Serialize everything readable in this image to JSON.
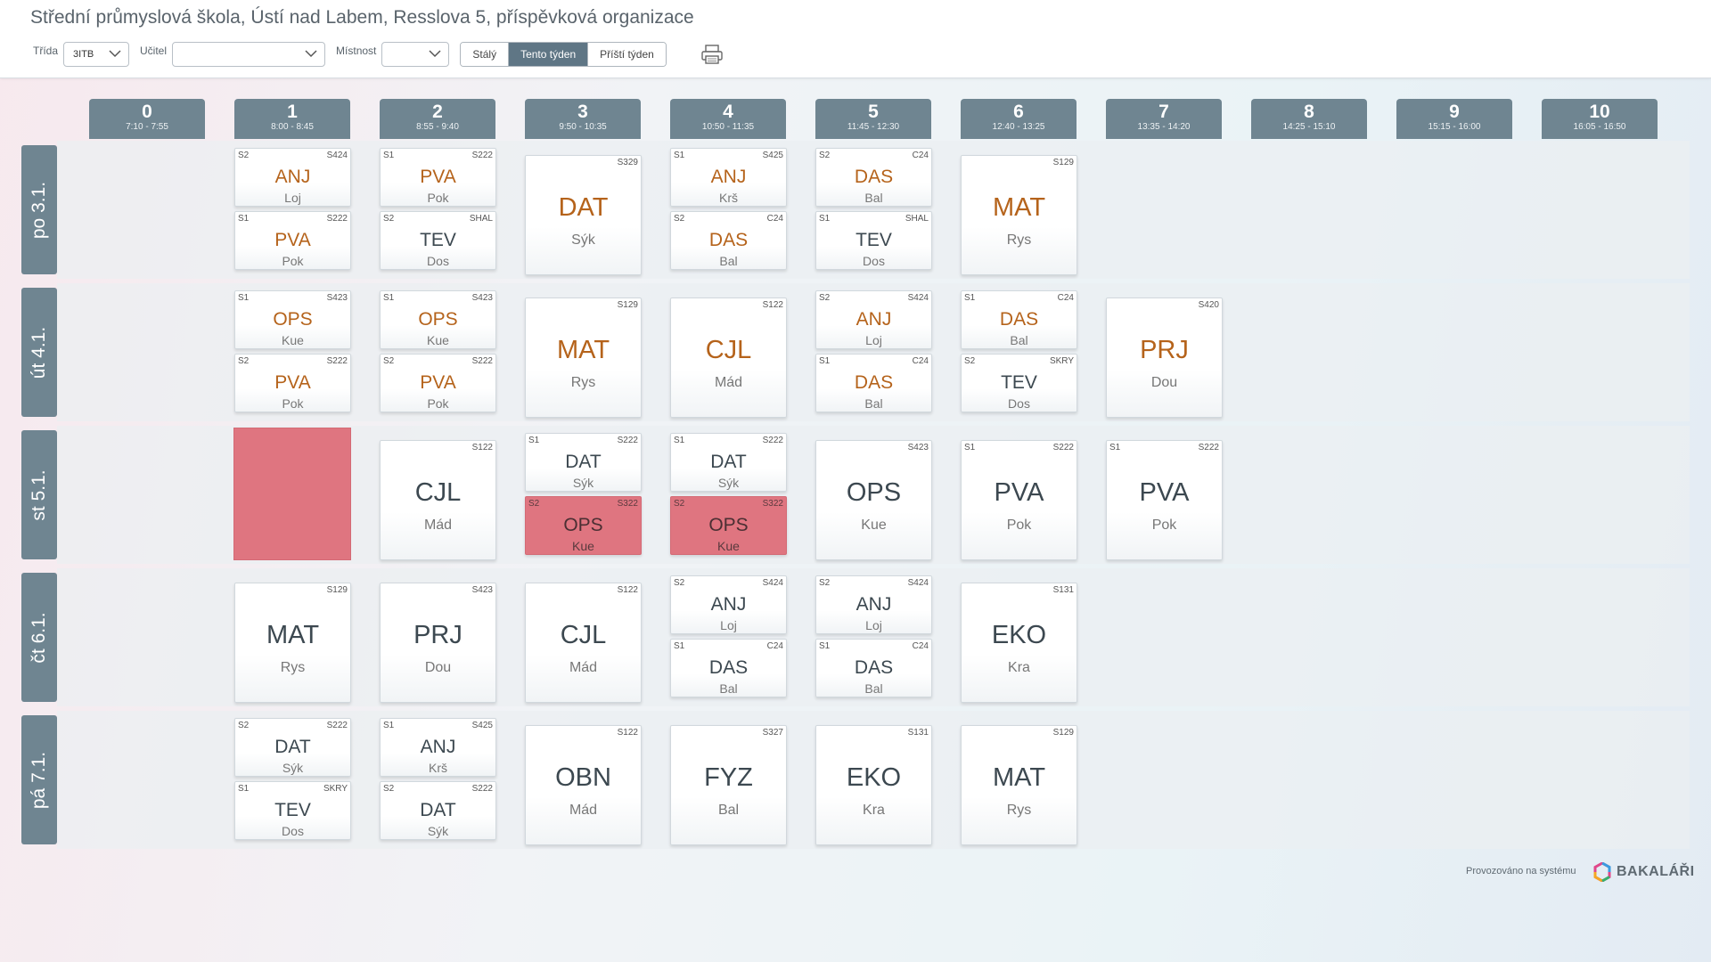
{
  "header": {
    "school": "Střední průmyslová škola, Ústí nad Labem, Resslova 5, příspěvková organizace",
    "filters": {
      "trida_label": "Třída",
      "trida_value": "3ITB",
      "ucitel_label": "Učitel",
      "ucitel_value": "",
      "mistnost_label": "Místnost",
      "mistnost_value": ""
    },
    "view_tabs": [
      "Stálý",
      "Tento týden",
      "Příští týden"
    ],
    "active_tab": "Tento týden",
    "print_icon": "printer-icon"
  },
  "hours": [
    {
      "num": "0",
      "time": "7:10 - 7:55"
    },
    {
      "num": "1",
      "time": "8:00 - 8:45"
    },
    {
      "num": "2",
      "time": "8:55 - 9:40"
    },
    {
      "num": "3",
      "time": "9:50 - 10:35"
    },
    {
      "num": "4",
      "time": "10:50 - 11:35"
    },
    {
      "num": "5",
      "time": "11:45 - 12:30"
    },
    {
      "num": "6",
      "time": "12:40 - 13:25"
    },
    {
      "num": "7",
      "time": "13:35 - 14:20"
    },
    {
      "num": "8",
      "time": "14:25 - 15:10"
    },
    {
      "num": "9",
      "time": "15:15 - 16:00"
    },
    {
      "num": "10",
      "time": "16:05 - 16:50"
    }
  ],
  "days": [
    "po 3.1.",
    "út 4.1.",
    "st 5.1.",
    "čt 6.1.",
    "pá 7.1."
  ],
  "lessons": [
    {
      "day": 0,
      "hour": 1,
      "slot": "top",
      "grp": "S2",
      "room": "S424",
      "subj": "ANJ",
      "teach": "Loj",
      "style": "orange"
    },
    {
      "day": 0,
      "hour": 1,
      "slot": "bottom",
      "grp": "S1",
      "room": "S222",
      "subj": "PVA",
      "teach": "Pok",
      "style": "orange"
    },
    {
      "day": 0,
      "hour": 2,
      "slot": "top",
      "grp": "S1",
      "room": "S222",
      "subj": "PVA",
      "teach": "Pok",
      "style": "orange"
    },
    {
      "day": 0,
      "hour": 2,
      "slot": "bottom",
      "grp": "S2",
      "room": "SHAL",
      "subj": "TEV",
      "teach": "Dos",
      "style": "dark"
    },
    {
      "day": 0,
      "hour": 3,
      "slot": "full",
      "grp": "",
      "room": "S329",
      "subj": "DAT",
      "teach": "Sýk",
      "style": "orange"
    },
    {
      "day": 0,
      "hour": 4,
      "slot": "top",
      "grp": "S1",
      "room": "S425",
      "subj": "ANJ",
      "teach": "Krš",
      "style": "orange"
    },
    {
      "day": 0,
      "hour": 4,
      "slot": "bottom",
      "grp": "S2",
      "room": "C24",
      "subj": "DAS",
      "teach": "Bal",
      "style": "orange"
    },
    {
      "day": 0,
      "hour": 5,
      "slot": "top",
      "grp": "S2",
      "room": "C24",
      "subj": "DAS",
      "teach": "Bal",
      "style": "orange"
    },
    {
      "day": 0,
      "hour": 5,
      "slot": "bottom",
      "grp": "S1",
      "room": "SHAL",
      "subj": "TEV",
      "teach": "Dos",
      "style": "dark"
    },
    {
      "day": 0,
      "hour": 6,
      "slot": "full",
      "grp": "",
      "room": "S129",
      "subj": "MAT",
      "teach": "Rys",
      "style": "orange"
    },
    {
      "day": 1,
      "hour": 1,
      "slot": "top",
      "grp": "S1",
      "room": "S423",
      "subj": "OPS",
      "teach": "Kue",
      "style": "orange"
    },
    {
      "day": 1,
      "hour": 1,
      "slot": "bottom",
      "grp": "S2",
      "room": "S222",
      "subj": "PVA",
      "teach": "Pok",
      "style": "orange"
    },
    {
      "day": 1,
      "hour": 2,
      "slot": "top",
      "grp": "S1",
      "room": "S423",
      "subj": "OPS",
      "teach": "Kue",
      "style": "orange"
    },
    {
      "day": 1,
      "hour": 2,
      "slot": "bottom",
      "grp": "S2",
      "room": "S222",
      "subj": "PVA",
      "teach": "Pok",
      "style": "orange"
    },
    {
      "day": 1,
      "hour": 3,
      "slot": "full",
      "grp": "",
      "room": "S129",
      "subj": "MAT",
      "teach": "Rys",
      "style": "orange"
    },
    {
      "day": 1,
      "hour": 4,
      "slot": "full",
      "grp": "",
      "room": "S122",
      "subj": "CJL",
      "teach": "Mád",
      "style": "orange"
    },
    {
      "day": 1,
      "hour": 5,
      "slot": "top",
      "grp": "S2",
      "room": "S424",
      "subj": "ANJ",
      "teach": "Loj",
      "style": "orange"
    },
    {
      "day": 1,
      "hour": 5,
      "slot": "bottom",
      "grp": "S1",
      "room": "C24",
      "subj": "DAS",
      "teach": "Bal",
      "style": "orange"
    },
    {
      "day": 1,
      "hour": 6,
      "slot": "top",
      "grp": "S1",
      "room": "C24",
      "subj": "DAS",
      "teach": "Bal",
      "style": "orange"
    },
    {
      "day": 1,
      "hour": 6,
      "slot": "bottom",
      "grp": "S2",
      "room": "SKRY",
      "subj": "TEV",
      "teach": "Dos",
      "style": "dark"
    },
    {
      "day": 1,
      "hour": 7,
      "slot": "full",
      "grp": "",
      "room": "S420",
      "subj": "PRJ",
      "teach": "Dou",
      "style": "orange"
    },
    {
      "day": 2,
      "hour": 1,
      "slot": "redfull",
      "grp": "",
      "room": "",
      "subj": "",
      "teach": "",
      "style": "red"
    },
    {
      "day": 2,
      "hour": 2,
      "slot": "full",
      "grp": "",
      "room": "S122",
      "subj": "CJL",
      "teach": "Mád",
      "style": "dark"
    },
    {
      "day": 2,
      "hour": 3,
      "slot": "top",
      "grp": "S1",
      "room": "S222",
      "subj": "DAT",
      "teach": "Sýk",
      "style": "dark"
    },
    {
      "day": 2,
      "hour": 3,
      "slot": "bottom",
      "grp": "S2",
      "room": "S322",
      "subj": "OPS",
      "teach": "Kue",
      "style": "red"
    },
    {
      "day": 2,
      "hour": 4,
      "slot": "top",
      "grp": "S1",
      "room": "S222",
      "subj": "DAT",
      "teach": "Sýk",
      "style": "dark"
    },
    {
      "day": 2,
      "hour": 4,
      "slot": "bottom",
      "grp": "S2",
      "room": "S322",
      "subj": "OPS",
      "teach": "Kue",
      "style": "red"
    },
    {
      "day": 2,
      "hour": 5,
      "slot": "full",
      "grp": "",
      "room": "S423",
      "subj": "OPS",
      "teach": "Kue",
      "style": "dark"
    },
    {
      "day": 2,
      "hour": 6,
      "slot": "full",
      "grp": "S1",
      "room": "S222",
      "subj": "PVA",
      "teach": "Pok",
      "style": "dark"
    },
    {
      "day": 2,
      "hour": 7,
      "slot": "full",
      "grp": "S1",
      "room": "S222",
      "subj": "PVA",
      "teach": "Pok",
      "style": "dark"
    },
    {
      "day": 3,
      "hour": 1,
      "slot": "full",
      "grp": "",
      "room": "S129",
      "subj": "MAT",
      "teach": "Rys",
      "style": "dark"
    },
    {
      "day": 3,
      "hour": 2,
      "slot": "full",
      "grp": "",
      "room": "S423",
      "subj": "PRJ",
      "teach": "Dou",
      "style": "dark"
    },
    {
      "day": 3,
      "hour": 3,
      "slot": "full",
      "grp": "",
      "room": "S122",
      "subj": "CJL",
      "teach": "Mád",
      "style": "dark"
    },
    {
      "day": 3,
      "hour": 4,
      "slot": "top",
      "grp": "S2",
      "room": "S424",
      "subj": "ANJ",
      "teach": "Loj",
      "style": "dark"
    },
    {
      "day": 3,
      "hour": 4,
      "slot": "bottom",
      "grp": "S1",
      "room": "C24",
      "subj": "DAS",
      "teach": "Bal",
      "style": "dark"
    },
    {
      "day": 3,
      "hour": 5,
      "slot": "top",
      "grp": "S2",
      "room": "S424",
      "subj": "ANJ",
      "teach": "Loj",
      "style": "dark"
    },
    {
      "day": 3,
      "hour": 5,
      "slot": "bottom",
      "grp": "S1",
      "room": "C24",
      "subj": "DAS",
      "teach": "Bal",
      "style": "dark"
    },
    {
      "day": 3,
      "hour": 6,
      "slot": "full",
      "grp": "",
      "room": "S131",
      "subj": "EKO",
      "teach": "Kra",
      "style": "dark"
    },
    {
      "day": 4,
      "hour": 1,
      "slot": "top",
      "grp": "S2",
      "room": "S222",
      "subj": "DAT",
      "teach": "Sýk",
      "style": "dark"
    },
    {
      "day": 4,
      "hour": 1,
      "slot": "bottom",
      "grp": "S1",
      "room": "SKRY",
      "subj": "TEV",
      "teach": "Dos",
      "style": "dark"
    },
    {
      "day": 4,
      "hour": 2,
      "slot": "top",
      "grp": "S1",
      "room": "S425",
      "subj": "ANJ",
      "teach": "Krš",
      "style": "dark"
    },
    {
      "day": 4,
      "hour": 2,
      "slot": "bottom",
      "grp": "S2",
      "room": "S222",
      "subj": "DAT",
      "teach": "Sýk",
      "style": "dark"
    },
    {
      "day": 4,
      "hour": 3,
      "slot": "full",
      "grp": "",
      "room": "S122",
      "subj": "OBN",
      "teach": "Mád",
      "style": "dark"
    },
    {
      "day": 4,
      "hour": 4,
      "slot": "full",
      "grp": "",
      "room": "S327",
      "subj": "FYZ",
      "teach": "Bal",
      "style": "dark"
    },
    {
      "day": 4,
      "hour": 5,
      "slot": "full",
      "grp": "",
      "room": "S131",
      "subj": "EKO",
      "teach": "Kra",
      "style": "dark"
    },
    {
      "day": 4,
      "hour": 6,
      "slot": "full",
      "grp": "",
      "room": "S129",
      "subj": "MAT",
      "teach": "Rys",
      "style": "dark"
    }
  ],
  "footer": {
    "operated_by": "Provozováno na systému",
    "brand": "BAKALÁŘI"
  }
}
